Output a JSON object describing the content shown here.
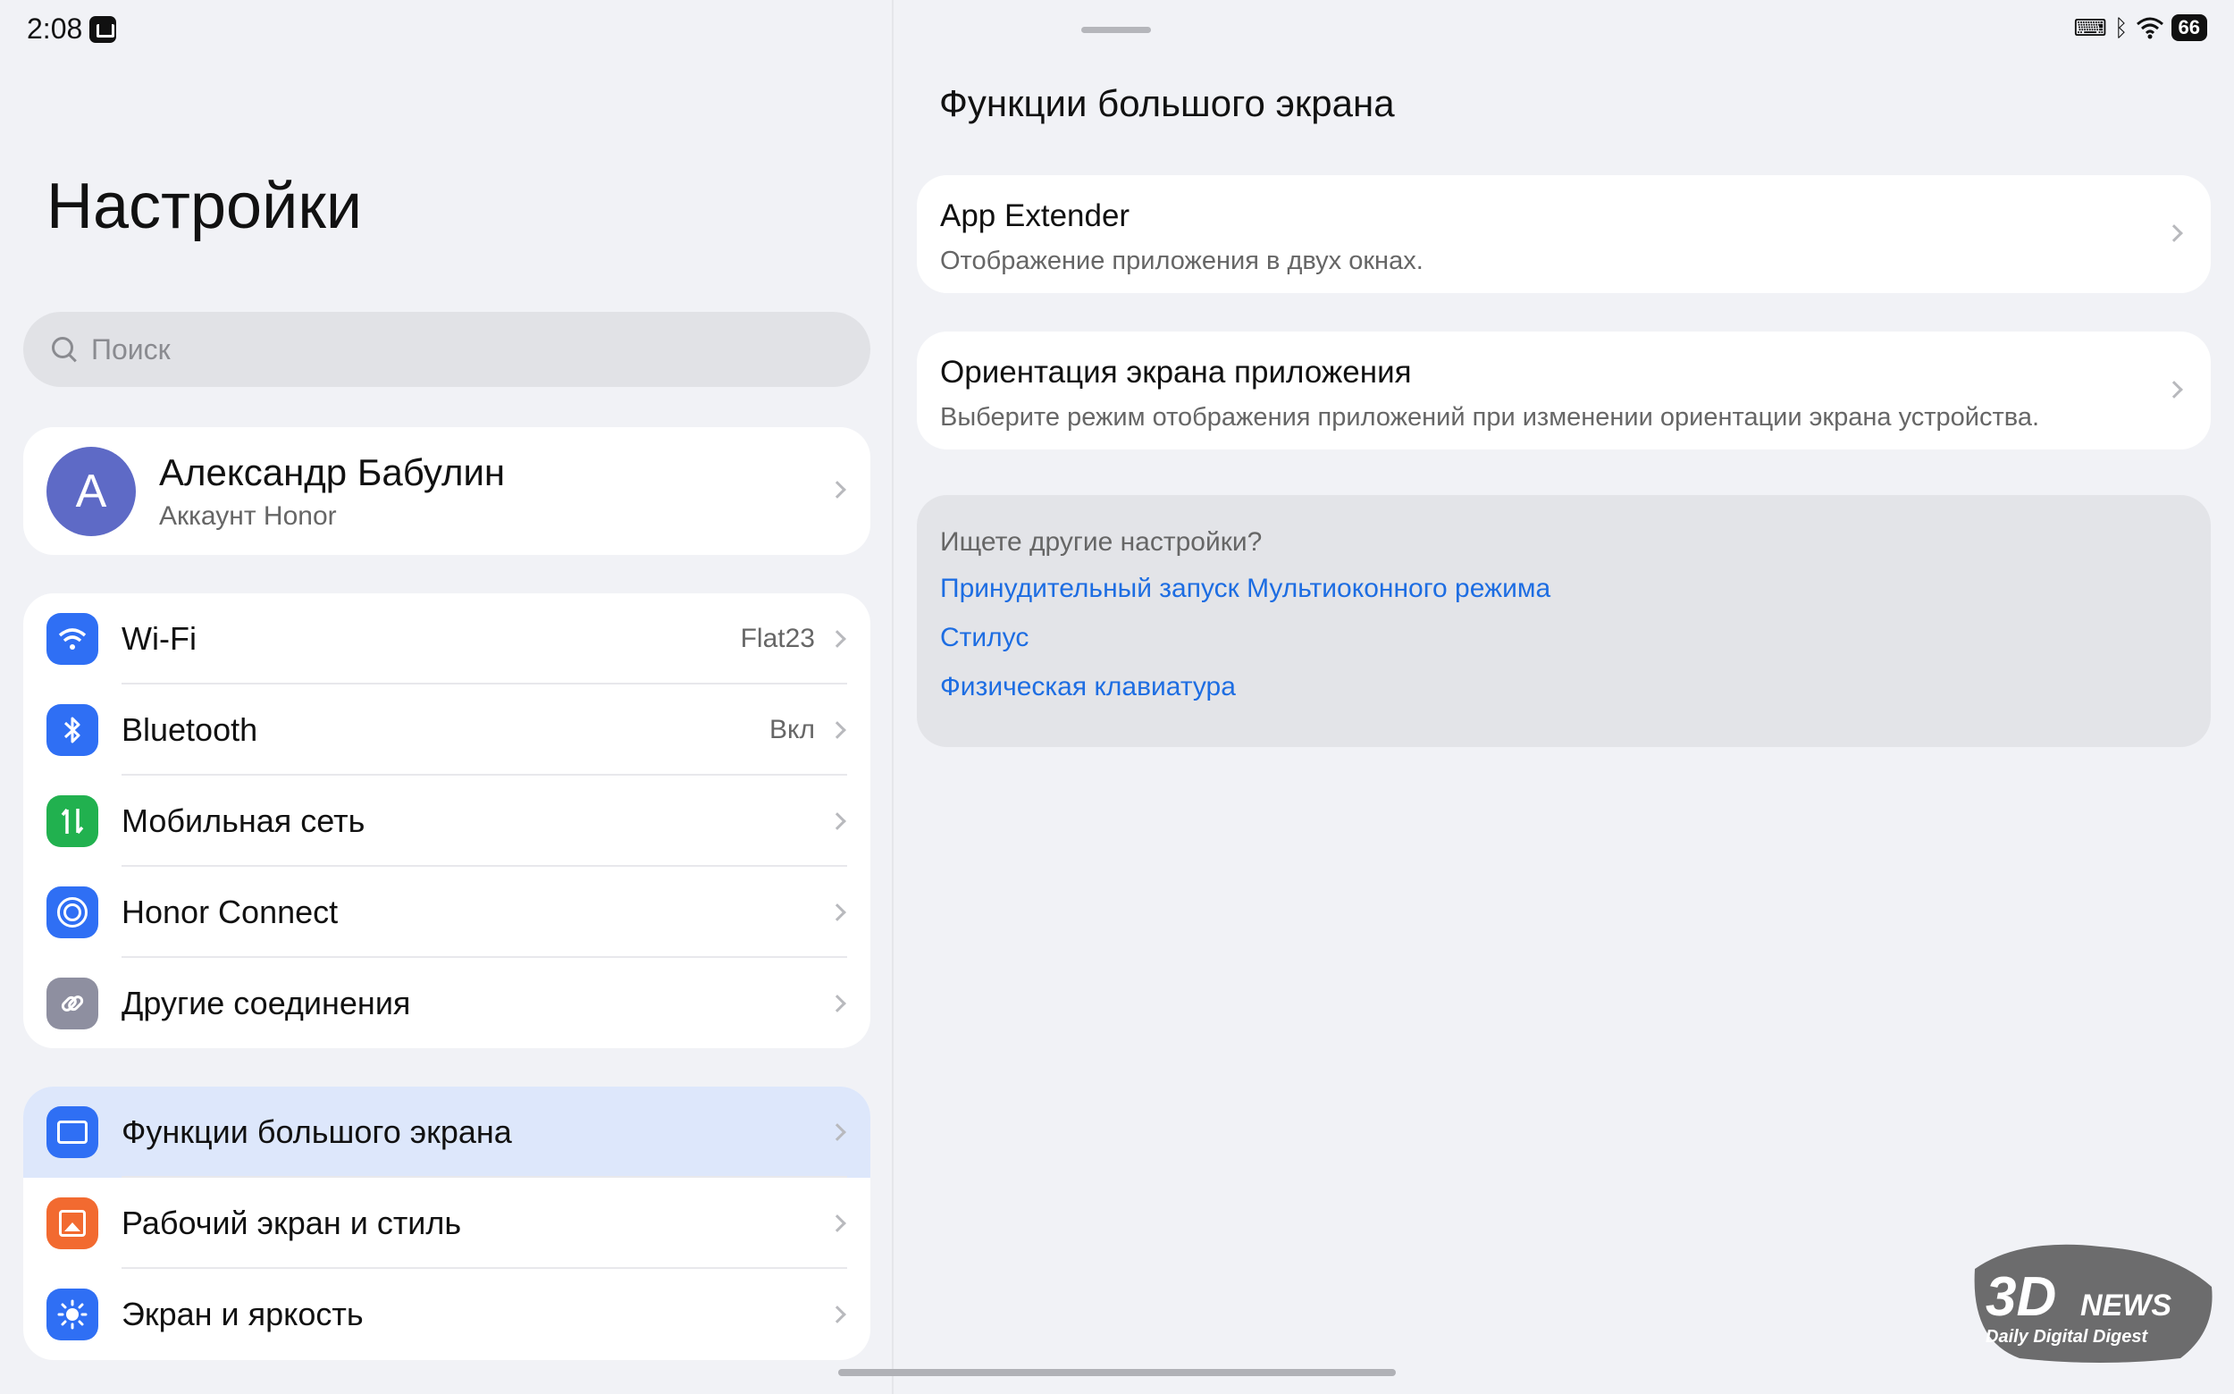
{
  "status_bar": {
    "time": "2:08",
    "battery": "66"
  },
  "left": {
    "title": "Настройки",
    "search": {
      "placeholder": "Поиск"
    },
    "profile": {
      "initial": "А",
      "name": "Александр Бабулин",
      "subtitle": "Аккаунт Honor"
    },
    "connections": [
      {
        "label": "Wi-Fi",
        "value": "Flat23",
        "icon": "wifi-icon"
      },
      {
        "label": "Bluetooth",
        "value": "Вкл",
        "icon": "bluetooth-icon"
      },
      {
        "label": "Мобильная сеть",
        "value": "",
        "icon": "mobile-network-icon"
      },
      {
        "label": "Honor Connect",
        "value": "",
        "icon": "honor-connect-icon"
      },
      {
        "label": "Другие соединения",
        "value": "",
        "icon": "link-icon"
      }
    ],
    "display": [
      {
        "label": "Функции большого экрана",
        "icon": "large-screen-icon",
        "selected": true
      },
      {
        "label": "Рабочий экран и стиль",
        "icon": "wallpaper-icon"
      },
      {
        "label": "Экран и яркость",
        "icon": "brightness-icon"
      }
    ]
  },
  "right": {
    "title": "Функции большого экрана",
    "items": [
      {
        "title": "App Extender",
        "description": "Отображение приложения в двух окнах."
      },
      {
        "title": "Ориентация экрана приложения",
        "description": "Выберите режим отображения приложений при изменении ориентации экрана устройства."
      }
    ],
    "more": {
      "question": "Ищете другие настройки?",
      "links": [
        "Принудительный запуск Мультиоконного режима",
        "Стилус",
        "Физическая клавиатура"
      ]
    }
  },
  "watermark": {
    "brand": "3DNEWS",
    "tagline": "Daily Digital Digest"
  },
  "colors": {
    "accent": "#2f6ff4",
    "link": "#1d6de2",
    "selected_bg": "#dde7fb",
    "mobile": "#21b14f",
    "wallpaper": "#f26a30",
    "avatar": "#5e6ac6"
  }
}
